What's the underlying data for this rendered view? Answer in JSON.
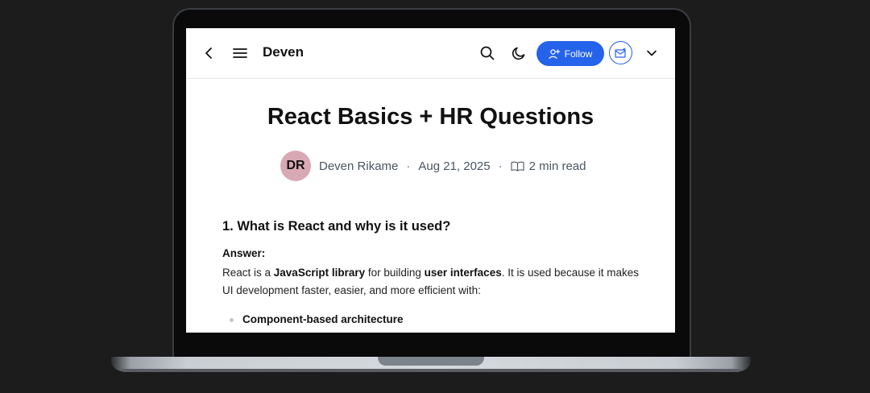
{
  "header": {
    "blog_title": "Deven",
    "follow_label": "Follow"
  },
  "article": {
    "title": "React Basics + HR Questions",
    "author_initials": "DR",
    "author_name": "Deven Rikame",
    "date": "Aug 21, 2025",
    "read_time": "2 min read",
    "question": "1. What is React and why is it used?",
    "answer_label": "Answer:",
    "para_1": "React is a ",
    "para_bold_1": "JavaScript library",
    "para_2": " for building ",
    "para_bold_2": "user interfaces",
    "para_3": ". It is used because it makes UI development faster, easier, and more efficient with:",
    "bullets": [
      "Component-based architecture"
    ]
  },
  "colors": {
    "accent": "#2563eb",
    "avatar_bg": "#d8a9b5"
  },
  "icons": {
    "back": "chevron-left-icon",
    "menu": "hamburger-icon",
    "search": "search-icon",
    "theme": "moon-icon",
    "follow": "user-plus-icon",
    "newsletter": "mail-icon",
    "dropdown": "chevron-down-icon",
    "read": "book-open-icon"
  }
}
